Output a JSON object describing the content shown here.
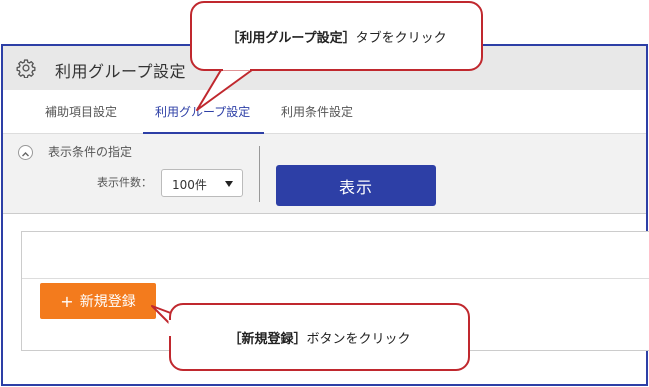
{
  "window": {
    "title": "利用グループ設定",
    "icon": "gear-icon"
  },
  "tabs": [
    {
      "label": "補助項目設定",
      "active": false
    },
    {
      "label": "利用グループ設定",
      "active": true
    },
    {
      "label": "利用条件設定",
      "active": false
    }
  ],
  "filter": {
    "section_title": "表示条件の指定",
    "count_label": "表示件数：",
    "count_value": "100件",
    "display_button": "表示"
  },
  "actions": {
    "new_button_plus": "+",
    "new_button_label": "新規登録"
  },
  "callouts": {
    "top": {
      "bracket_text": "［利用グループ設定］",
      "rest_text": "タブをクリック"
    },
    "bottom": {
      "bracket_text": "［新規登録］",
      "rest_text": "ボタンをクリック"
    }
  },
  "colors": {
    "accent": "#2d3fa6",
    "new_button": "#f37b1d",
    "callout_border": "#c0282e"
  }
}
